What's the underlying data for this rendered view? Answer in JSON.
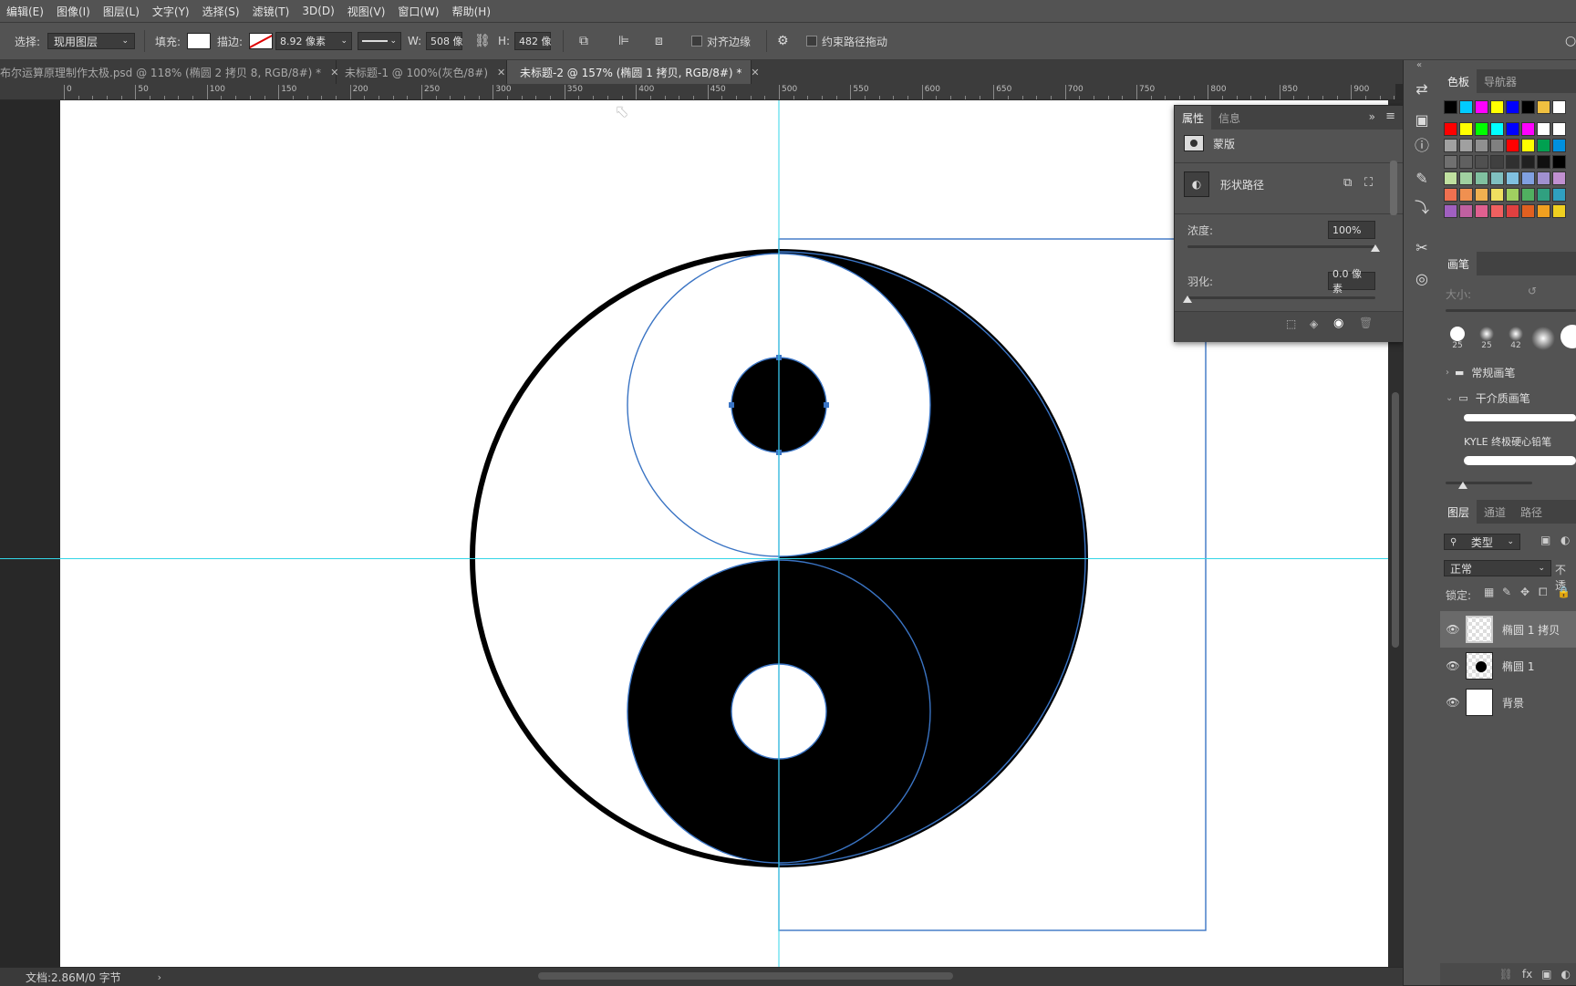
{
  "menu": [
    "编辑(E)",
    "图像(I)",
    "图层(L)",
    "文字(Y)",
    "选择(S)",
    "滤镜(T)",
    "3D(D)",
    "视图(V)",
    "窗口(W)",
    "帮助(H)"
  ],
  "options": {
    "select_label": "选择:",
    "select_value": "现用图层",
    "fill_label": "填充:",
    "stroke_label": "描边:",
    "stroke_width": "8.92 像素",
    "w_label": "W:",
    "w_value": "508 像",
    "h_label": "H:",
    "h_value": "482 像",
    "align_edges": "对齐边缘",
    "constrain_path": "约束路径拖动"
  },
  "doc_tabs": [
    {
      "label": "布尔运算原理制作太极.psd @ 118% (椭圆 2 拷贝 8, RGB/8#) *",
      "active": false
    },
    {
      "label": "未标题-1 @ 100%(灰色/8#)",
      "active": false
    },
    {
      "label": "未标题-2 @ 157% (椭圆 1 拷贝, RGB/8#) *",
      "active": true
    }
  ],
  "ruler_labels": [
    "0",
    "50",
    "100",
    "150",
    "200",
    "250",
    "300",
    "350",
    "400",
    "450",
    "500",
    "550",
    "600",
    "650",
    "700",
    "750",
    "800",
    "850",
    "900"
  ],
  "properties": {
    "tabs": [
      "属性",
      "信息"
    ],
    "mask": "蒙版",
    "shape_path": "形状路径",
    "density_label": "浓度:",
    "density_value": "100%",
    "feather_label": "羽化:",
    "feather_value": "0.0 像素",
    "density_fraction": 1.0,
    "feather_fraction": 0.0
  },
  "swatches_panel": {
    "tabs": [
      "色板",
      "导航器"
    ],
    "colors": [
      "#000000",
      "#00ccff",
      "#ff00ff",
      "#ffff00",
      "#0000ff",
      "#000000",
      "#f0c040",
      "#ffffff",
      "#ff0000",
      "#ffff00",
      "#00ff00",
      "#00ffff",
      "#0000ff",
      "#ff00ff",
      "#ffffff",
      "#ffffff",
      "#a0a0a0",
      "#a0a0a0",
      "#909090",
      "#808080",
      "#ff0000",
      "#ffff00",
      "#00a050",
      "#0090e0",
      "#707070",
      "#606060",
      "#505050",
      "#404040",
      "#303030",
      "#202020",
      "#101010",
      "#000000",
      "#c0e0a0",
      "#a0d0a0",
      "#80c0a0",
      "#80c0c0",
      "#80c0e0",
      "#80a0e0",
      "#a090d0",
      "#c090d0",
      "#f07050",
      "#f09050",
      "#f0b050",
      "#f0e060",
      "#a0d060",
      "#50b060",
      "#30a080",
      "#30a0c0",
      "#a060c0",
      "#c060a0",
      "#e06090",
      "#f06060",
      "#e04040",
      "#e06020",
      "#f0a020",
      "#f0d020"
    ]
  },
  "brush_panel": {
    "tab": "画笔",
    "size_label": "大小:",
    "tips": [
      "25",
      "25",
      "42",
      "",
      ""
    ],
    "groups": [
      "常规画笔",
      "干介质画笔"
    ],
    "brush_name": "KYLE 终极硬心铅笔"
  },
  "layers_panel": {
    "tabs": [
      "图层",
      "通道",
      "路径"
    ],
    "filter": "类型",
    "blend": "正常",
    "opacity_abbr": "不透",
    "lock_label": "锁定:",
    "layers": [
      {
        "name": "椭圆 1 拷贝",
        "selected": true
      },
      {
        "name": "椭圆 1",
        "selected": false
      },
      {
        "name": "背景",
        "selected": false
      }
    ]
  },
  "status": {
    "doc_info": "文档:2.86M/0 字节"
  }
}
